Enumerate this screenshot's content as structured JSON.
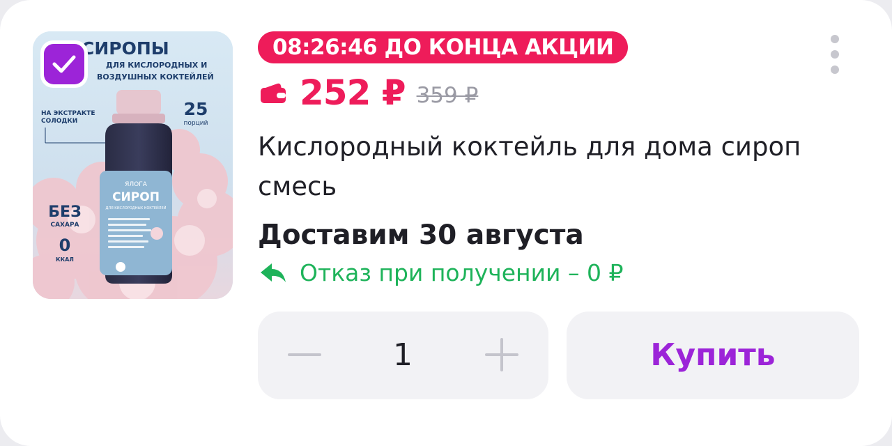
{
  "product": {
    "image": {
      "alt": "Сироп для кислородных коктейлей",
      "headline_1": "СИРОПЫ",
      "headline_2": "ДЛЯ КИСЛОРОДНЫХ И",
      "headline_3": "ВОЗДУШНЫХ КОКТЕЙЛЕЙ",
      "extract_1": "НА ЭКСТРАКТЕ",
      "extract_2": "СОЛОДКИ",
      "portions_num": "25",
      "portions_label": "порций",
      "no_sugar_1": "БЕЗ",
      "no_sugar_2": "САХАРА",
      "kcal_num": "0",
      "kcal_label": "ККАЛ",
      "brand": "ЯЛОГА",
      "label_title": "СИРОП",
      "label_sub": "ДЛЯ КИСЛОРОДНЫХ КОКТЕЙЛЕЙ"
    },
    "selected": true,
    "timer_label": "08:26:46 ДО КОНЦА АКЦИИ",
    "price": "252 ₽",
    "old_price": "359 ₽",
    "title": "Кислородный коктейль для дома сироп смесь",
    "delivery": "Доставим 30 августа",
    "return_text": "Отказ при получении – 0 ₽",
    "quantity": "1",
    "buy_label": "Купить"
  },
  "icons": {
    "check": "checkmark-icon",
    "more": "more-vertical-icon",
    "wallet": "wallet-icon",
    "return": "return-arrow-icon",
    "minus": "minus-icon",
    "plus": "plus-icon"
  },
  "colors": {
    "accent": "#9c24d8",
    "sale": "#ee1c5a",
    "return_green": "#1eb35a",
    "muted": "#9a9aa4"
  }
}
